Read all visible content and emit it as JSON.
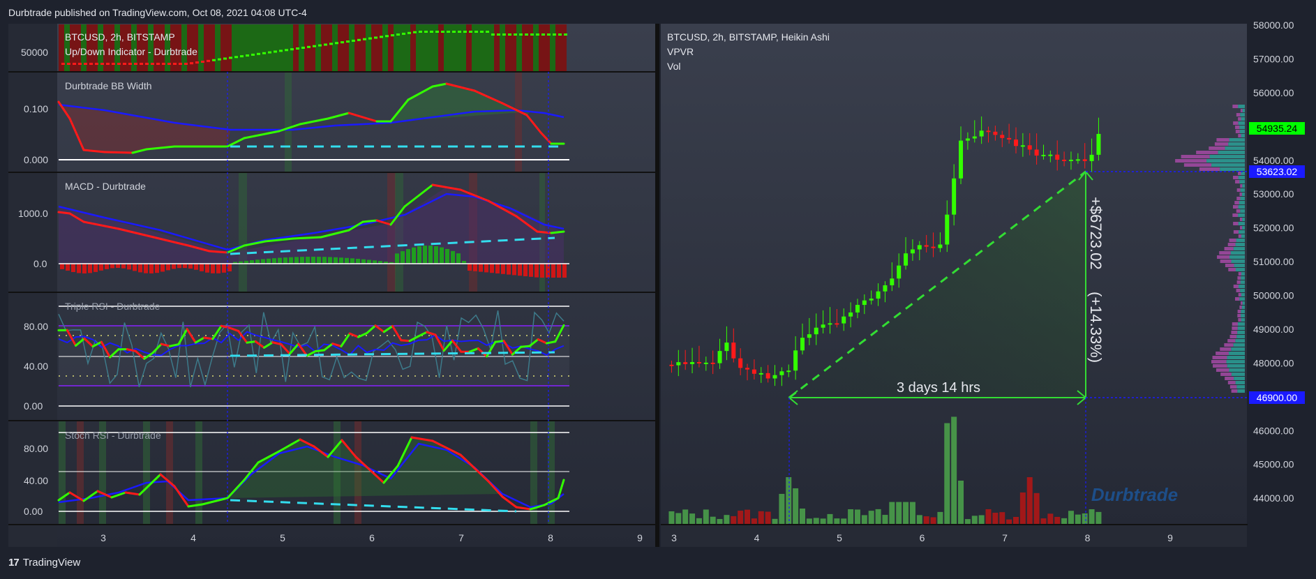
{
  "header": {
    "text": "Durbtrade published on TradingView.com, Oct 08, 2021 04:08 UTC-4"
  },
  "footer": {
    "logo": "17",
    "brand": "TradingView"
  },
  "colors": {
    "bull": "#33ff00",
    "bear": "#ff1a1a",
    "blue": "#1a1aff",
    "cyan": "#33ddee",
    "bg": "#1e222d"
  },
  "panes": {
    "updown": {
      "title1": "BTCUSD, 2h, BITSTAMP",
      "title2": "Up/Down Indicator - Durbtrade",
      "level": "50000"
    },
    "bbwidth": {
      "title": "Durbtrade BB Width",
      "ticks": [
        "0.100",
        "0.000"
      ]
    },
    "macd": {
      "title": "MACD - Durbtrade",
      "ticks": [
        "1000.0",
        "0.0"
      ]
    },
    "rsi": {
      "title": "Triple RSI - Durbtrade",
      "ticks": [
        "80.00",
        "40.00",
        "0.00"
      ]
    },
    "stoch": {
      "title": "Stoch RSI - Durbtrade",
      "ticks": [
        "80.00",
        "40.00",
        "0.00"
      ]
    }
  },
  "left_xaxis": [
    "3",
    "4",
    "5",
    "6",
    "7",
    "8",
    "9"
  ],
  "right": {
    "title1": "BTCUSD, 2h, BITSTAMP, Heikin Ashi",
    "title2": "VPVR",
    "title3": "Vol",
    "xaxis": [
      "3",
      "4",
      "5",
      "6",
      "7",
      "8",
      "9"
    ],
    "yaxis": [
      "58000.00",
      "57000.00",
      "56000.00",
      "55000.00",
      "54000.00",
      "53000.00",
      "52000.00",
      "51000.00",
      "50000.00",
      "49000.00",
      "48000.00",
      "47000.00",
      "46000.00",
      "45000.00",
      "44000.00"
    ],
    "last_price": "54935.24",
    "level_high": "53623.02",
    "level_low": "46900.00",
    "measure_price": "+$6723.02",
    "measure_pct": "(+14.33%)",
    "measure_time": "3 days 14 hrs",
    "watermark": "Durbtrade"
  },
  "chart_data": {
    "type": "candlestick",
    "title": "BTCUSD, 2h, BITSTAMP, Heikin Ashi",
    "x_day_ticks": [
      3,
      4,
      5,
      6,
      7,
      8,
      9
    ],
    "ylim": [
      43500,
      58000
    ],
    "ha_close_path": [
      [
        3.0,
        47950
      ],
      [
        3.3,
        47980
      ],
      [
        3.5,
        48100
      ],
      [
        3.6,
        48700
      ],
      [
        3.7,
        48200
      ],
      [
        3.85,
        47800
      ],
      [
        4.0,
        47650
      ],
      [
        4.2,
        47600
      ],
      [
        4.4,
        47800
      ],
      [
        4.5,
        48700
      ],
      [
        4.7,
        49000
      ],
      [
        5.0,
        49200
      ],
      [
        5.2,
        49600
      ],
      [
        5.4,
        50000
      ],
      [
        5.6,
        50300
      ],
      [
        5.8,
        51200
      ],
      [
        6.0,
        51450
      ],
      [
        6.2,
        51300
      ],
      [
        6.35,
        53000
      ],
      [
        6.45,
        54500
      ],
      [
        6.6,
        54700
      ],
      [
        6.75,
        54950
      ],
      [
        7.0,
        54600
      ],
      [
        7.2,
        54400
      ],
      [
        7.4,
        54200
      ],
      [
        7.6,
        54050
      ],
      [
        7.8,
        54050
      ],
      [
        8.0,
        54050
      ],
      [
        8.1,
        54400
      ],
      [
        8.15,
        54900
      ]
    ],
    "volume_spikes": [
      {
        "day": 4.4,
        "rel": 0.4
      },
      {
        "day": 6.35,
        "rel": 1.0
      },
      {
        "day": 7.3,
        "rel": 0.38
      }
    ],
    "measure": {
      "from": 46900.0,
      "to": 53623.02,
      "change": 6723.02,
      "pct": 14.33,
      "duration": "3 days 14 hrs"
    }
  }
}
